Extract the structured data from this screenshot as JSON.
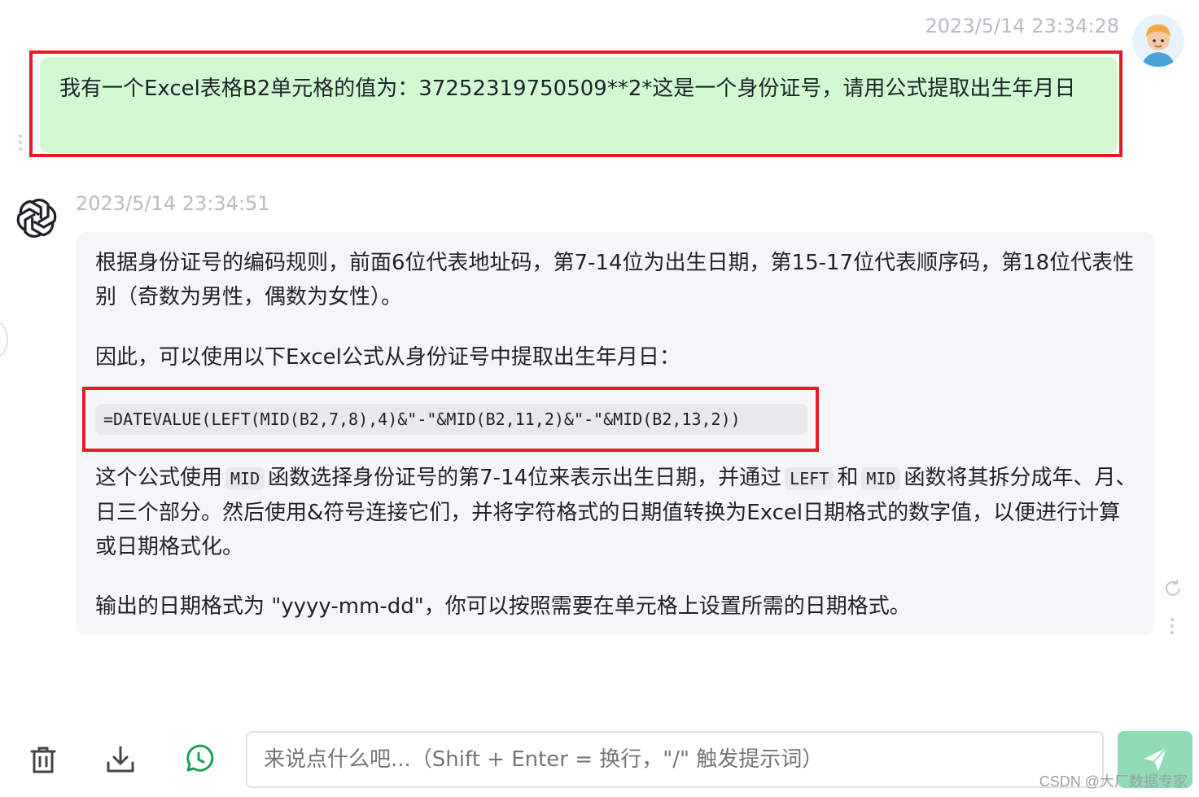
{
  "user_message": {
    "timestamp": "2023/5/14 23:34:28",
    "text": "我有一个Excel表格B2单元格的值为：37252319750509**2*这是一个身份证号，请用公式提取出生年月日"
  },
  "assistant_message": {
    "timestamp": "2023/5/14 23:34:51",
    "paragraph1": "根据身份证号的编码规则，前面6位代表地址码，第7-14位为出生日期，第15-17位代表顺序码，第18位代表性别（奇数为男性，偶数为女性）。",
    "paragraph2": "因此，可以使用以下Excel公式从身份证号中提取出生年月日：",
    "code": "=DATEVALUE(LEFT(MID(B2,7,8),4)&\"-\"&MID(B2,11,2)&\"-\"&MID(B2,13,2))",
    "paragraph3": {
      "part1": "这个公式使用",
      "code1": "MID",
      "part2": "函数选择身份证号的第7-14位来表示出生日期，并通过",
      "code2": "LEFT",
      "part3": "和",
      "code3": "MID",
      "part4": "函数将其拆分成年、月、日三个部分。然后使用&符号连接它们，并将字符格式的日期值转换为Excel日期格式的数字值，以便进行计算或日期格式化。"
    },
    "paragraph4": "输出的日期格式为 \"yyyy-mm-dd\"，你可以按照需要在单元格上设置所需的日期格式。"
  },
  "input": {
    "placeholder": "来说点什么吧...（Shift + Enter = 换行，\"/\" 触发提示词）"
  },
  "toolbar": {
    "icons": [
      "trash-icon",
      "download-icon",
      "history-icon"
    ]
  },
  "watermark": "CSDN @大厂数据专家",
  "colors": {
    "user_bubble": "#d2f9d1",
    "assistant_bubble": "#f4f6f8",
    "highlight_border": "#e21d28",
    "send_button": "#8fdcb4",
    "history_icon": "#18a058"
  }
}
